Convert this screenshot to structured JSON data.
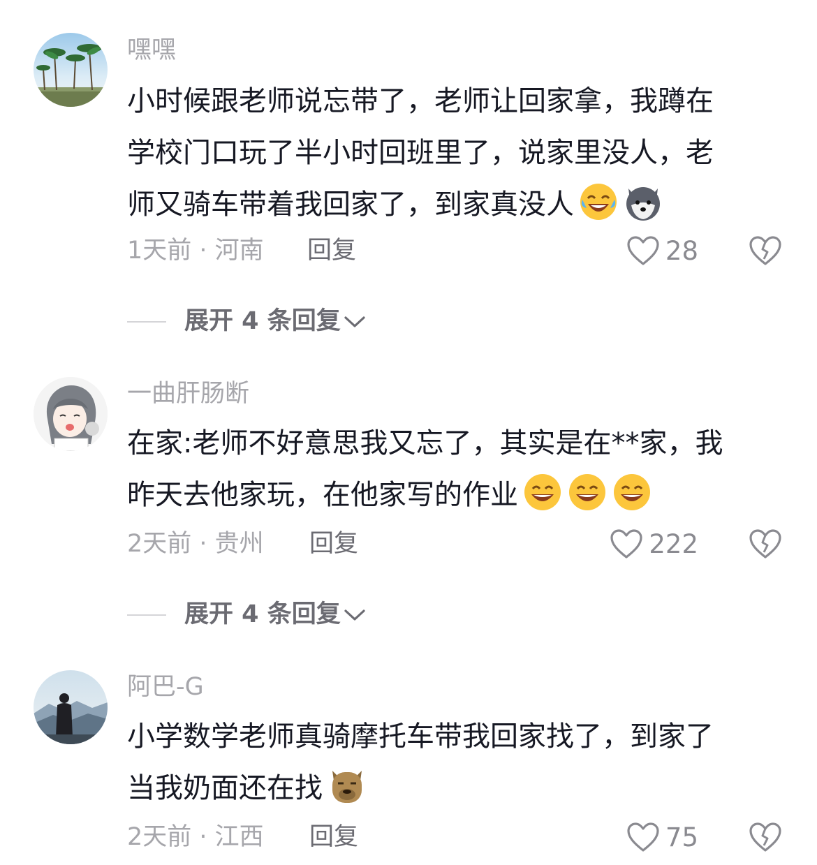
{
  "comments": [
    {
      "username": "嘿嘿",
      "avatar": "palm-trees-beach-photo",
      "text": "小时候跟老师说忘带了，老师让回家拿，我蹲在\n学校门口玩了半小时回班里了，说家里没人，老\n师又骑车带着我回家了，到家真没人",
      "emojis": [
        "laughing-tears-emoji",
        "husky-dog-emoji"
      ],
      "time_location": "1天前 · 河南",
      "reply_label": "回复",
      "likes": "28",
      "expand_label": "展开 4 条回复"
    },
    {
      "username": "一曲肝肠断",
      "avatar": "anime-girl-avatar",
      "text": "在家:老师不好意思我又忘了，其实是在**家，我\n昨天去他家玩，在他家写的作业",
      "emojis": [
        "grinning-emoji",
        "grinning-emoji",
        "grinning-emoji"
      ],
      "time_location": "2天前 · 贵州",
      "reply_label": "回复",
      "likes": "222",
      "expand_label": "展开 4 条回复"
    },
    {
      "username": "阿巴-G",
      "avatar": "person-mountain-photo",
      "text": "小学数学老师真骑摩托车带我回家找了，到家了\n当我奶面还在找",
      "emojis": [
        "capybara-emoji"
      ],
      "time_location": "2天前 · 江西",
      "reply_label": "回复",
      "likes": "75"
    }
  ],
  "colors": {
    "text": "#161823",
    "muted": "#a6a6ab",
    "reply": "#6b6b72",
    "background": "#ffffff"
  }
}
